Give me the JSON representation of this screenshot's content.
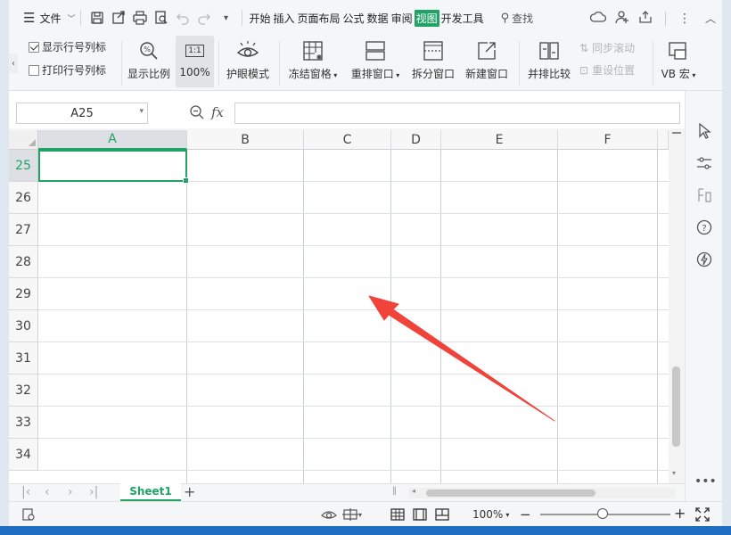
{
  "menu": {
    "file_label": "文件",
    "tabs": [
      "开始",
      "插入",
      "页面布局",
      "公式",
      "数据",
      "审阅",
      "视图",
      "开发工具"
    ],
    "active_tab": "视图",
    "search_label": "查找"
  },
  "ribbon": {
    "show_rowcol_label": "显示行号列标",
    "print_rowcol_label": "打印行号列标",
    "show_rowcol_checked": true,
    "print_rowcol_checked": false,
    "zoom_label": "显示比例",
    "hundred_label": "100%",
    "hundred_icon_text": "1:1",
    "eye_mode_label": "护眼模式",
    "freeze_label": "冻结窗格",
    "arrange_label": "重排窗口",
    "split_label": "拆分窗口",
    "new_window_label": "新建窗口",
    "side_by_side_label": "并排比较",
    "sync_scroll_label": "同步滚动",
    "reset_pos_label": "重设位置",
    "vb_macro_label": "VB 宏"
  },
  "formula_bar": {
    "name_box": "A25",
    "fx_label": "fx",
    "formula_value": ""
  },
  "grid": {
    "columns": [
      "A",
      "B",
      "C",
      "D",
      "E",
      "F"
    ],
    "rows": [
      "25",
      "26",
      "27",
      "28",
      "29",
      "30",
      "31",
      "32",
      "33",
      "34"
    ],
    "active_cell": "A25",
    "active_column": "A",
    "active_row": "25"
  },
  "sheets": {
    "tabs": [
      "Sheet1"
    ],
    "active": "Sheet1",
    "add_label": "+"
  },
  "status_bar": {
    "zoom_value": "100%",
    "minus": "−",
    "plus": "+"
  },
  "annotation": {
    "type": "red-arrow",
    "color": "#f0433a"
  },
  "colors": {
    "accent": "#21a366"
  }
}
